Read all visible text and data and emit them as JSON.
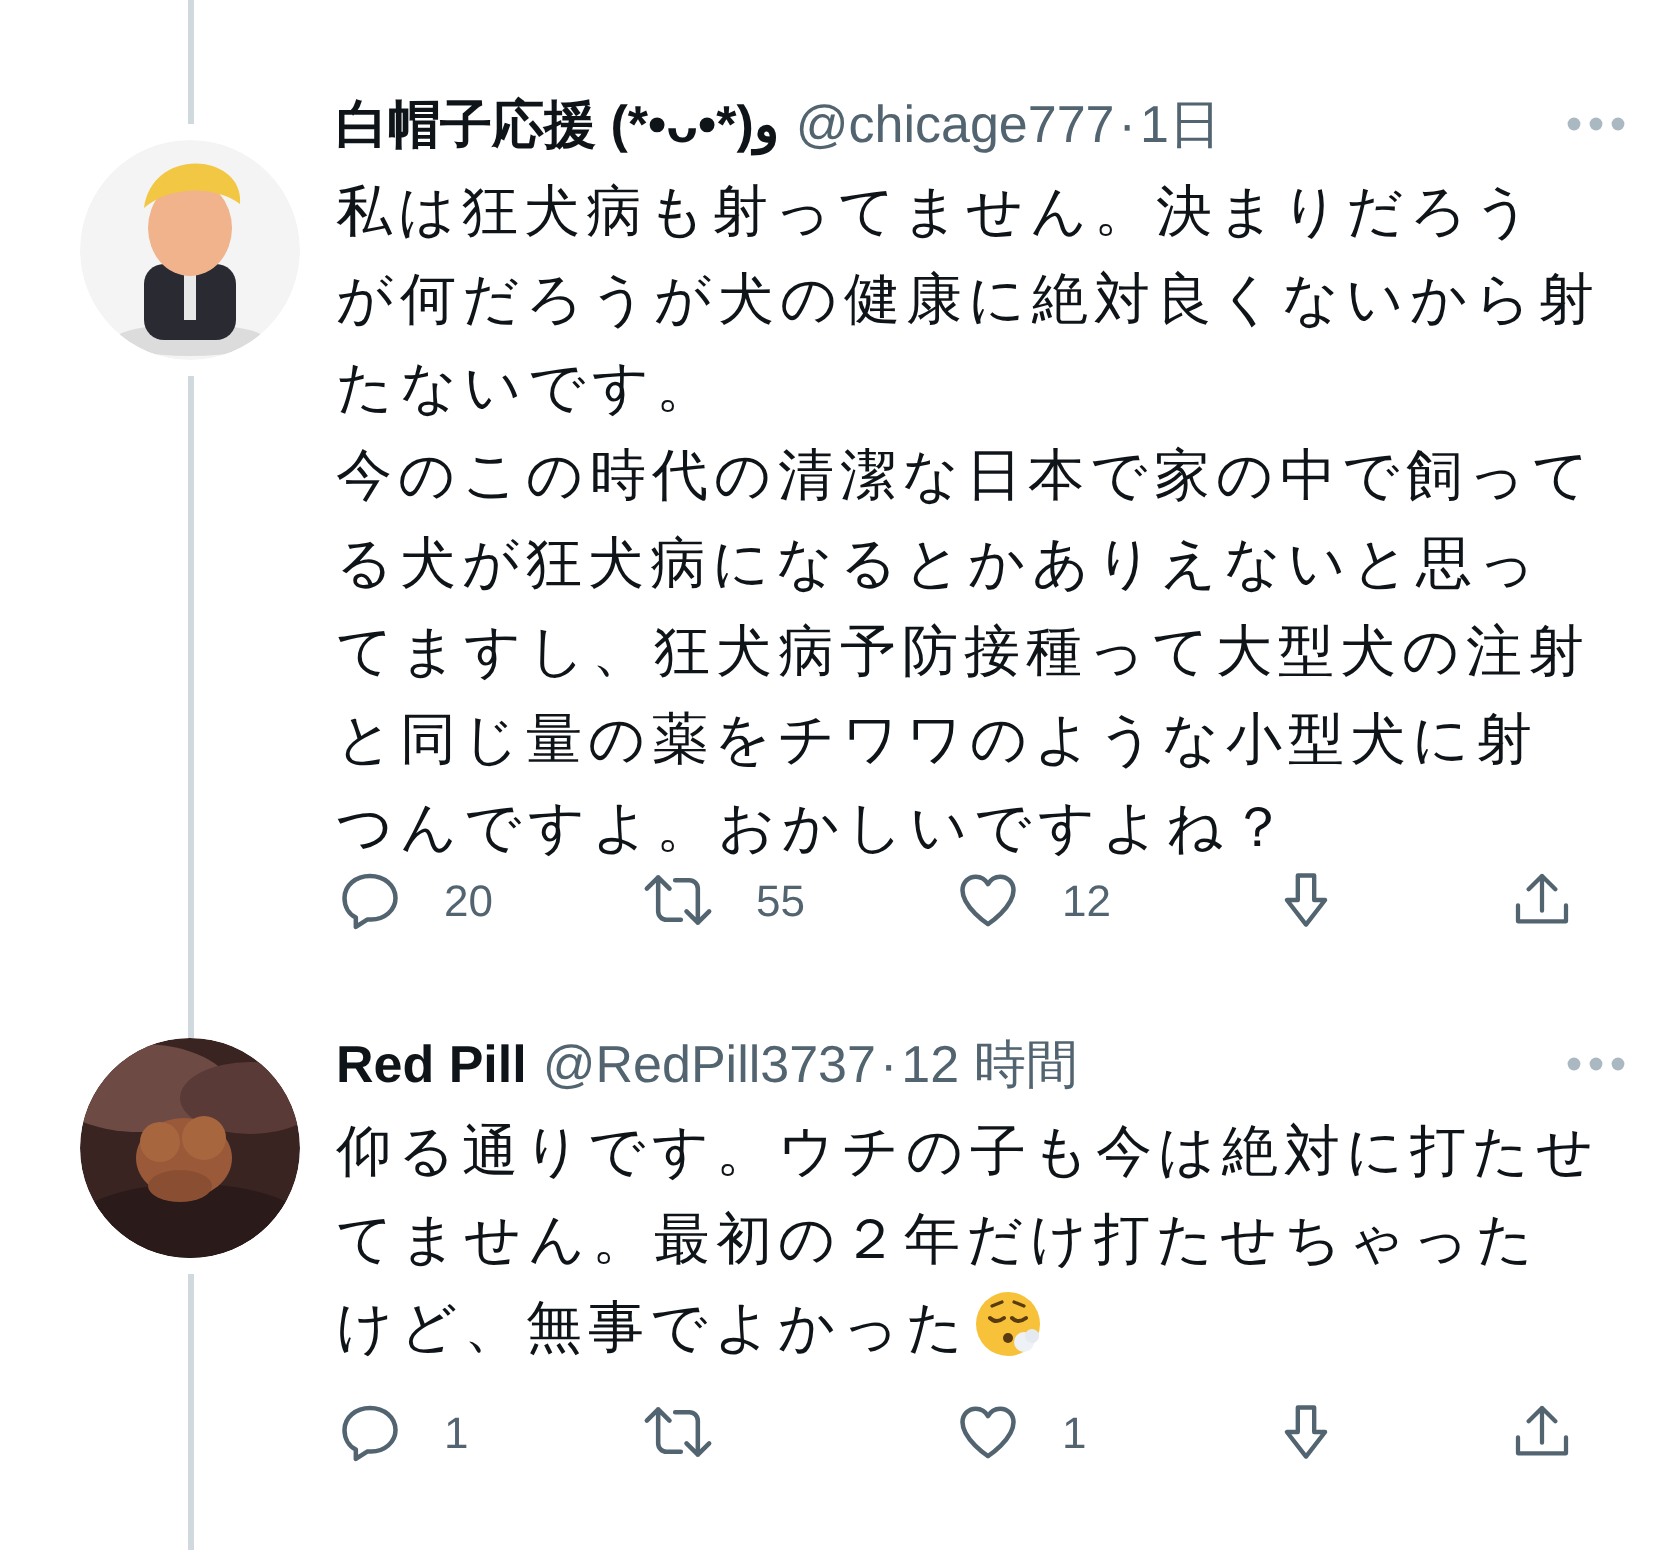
{
  "tweets": [
    {
      "avatar": {
        "kind": "picture"
      },
      "display_name": "白帽子応援 (*•ᴗ•*)و",
      "handle": "@chicage777",
      "separator": "·",
      "time": "1日",
      "text": [
        "私は狂犬病も射ってません。決まりだろうが何だろうが犬の健康に絶対良くないから射たないです。",
        "今のこの時代の清潔な日本で家の中で飼ってる犬が狂犬病になるとかありえないと思ってますし、狂犬病予防接種って大型犬の注射と同じ量の薬をチワワのような小型犬に射つんですよ。おかしいですよね？"
      ],
      "emoji": false,
      "actions": [
        {
          "kind": "reply",
          "count": "20"
        },
        {
          "kind": "retweet",
          "count": "55"
        },
        {
          "kind": "like",
          "count": "12"
        },
        {
          "kind": "download"
        },
        {
          "kind": "share"
        }
      ]
    },
    {
      "avatar": {
        "kind": "picture"
      },
      "display_name": "Red Pill",
      "handle": "@RedPill3737",
      "separator": "·",
      "time": "12 時間",
      "text": [
        "仰る通りです。ウチの子も今は絶対に打たせてません。最初の２年だけ打たせちゃったけど、無事でよかった"
      ],
      "emoji": true,
      "actions": [
        {
          "kind": "reply",
          "count": "1"
        },
        {
          "kind": "retweet"
        },
        {
          "kind": "like",
          "count": "1"
        },
        {
          "kind": "download"
        },
        {
          "kind": "share"
        }
      ]
    }
  ]
}
